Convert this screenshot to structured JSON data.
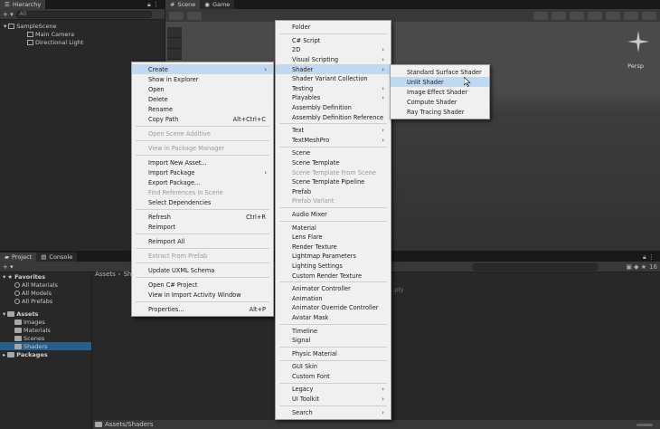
{
  "hierarchy": {
    "tab_label": "Hierarchy",
    "add_label": "+ ▾",
    "search_placeholder": "All",
    "items": [
      {
        "label": "SampleScene"
      },
      {
        "label": "Main Camera"
      },
      {
        "label": "Directional Light"
      }
    ]
  },
  "scene": {
    "tabs": [
      {
        "label": "Scene"
      },
      {
        "label": "Game"
      }
    ],
    "gizmo_label": "Persp"
  },
  "project": {
    "tabs": [
      {
        "label": "Project"
      },
      {
        "label": "Console"
      }
    ],
    "favorites_label": "Favorites",
    "favorites": [
      "All Materials",
      "All Models",
      "All Prefabs"
    ],
    "assets_label": "Assets",
    "asset_folders": [
      "Images",
      "Materials",
      "Scenes",
      "Shaders"
    ],
    "packages_label": "Packages",
    "breadcrumb": [
      "Assets",
      "Shad"
    ],
    "empty_hint": "...pty",
    "path_label": "Assets/Shaders",
    "count_label": "16"
  },
  "context_menu": {
    "items": [
      {
        "label": "Create",
        "submenu": true,
        "highlighted": true
      },
      {
        "label": "Show in Explorer"
      },
      {
        "label": "Open"
      },
      {
        "label": "Delete"
      },
      {
        "label": "Rename"
      },
      {
        "label": "Copy Path",
        "shortcut": "Alt+Ctrl+C"
      },
      {
        "sep": true
      },
      {
        "label": "Open Scene Additive",
        "disabled": true
      },
      {
        "sep": true
      },
      {
        "label": "View in Package Manager",
        "disabled": true
      },
      {
        "sep": true
      },
      {
        "label": "Import New Asset..."
      },
      {
        "label": "Import Package",
        "submenu": true
      },
      {
        "label": "Export Package..."
      },
      {
        "label": "Find References In Scene",
        "disabled": true
      },
      {
        "label": "Select Dependencies"
      },
      {
        "sep": true
      },
      {
        "label": "Refresh",
        "shortcut": "Ctrl+R"
      },
      {
        "label": "Reimport"
      },
      {
        "sep": true
      },
      {
        "label": "Reimport All"
      },
      {
        "sep": true
      },
      {
        "label": "Extract From Prefab",
        "disabled": true
      },
      {
        "sep": true
      },
      {
        "label": "Update UXML Schema"
      },
      {
        "sep": true
      },
      {
        "label": "Open C# Project"
      },
      {
        "label": "View in Import Activity Window"
      },
      {
        "sep": true
      },
      {
        "label": "Properties...",
        "shortcut": "Alt+P"
      }
    ]
  },
  "create_menu": {
    "items": [
      {
        "label": "Folder"
      },
      {
        "sep": true
      },
      {
        "label": "C# Script"
      },
      {
        "label": "2D",
        "submenu": true
      },
      {
        "label": "Visual Scripting",
        "submenu": true
      },
      {
        "label": "Shader",
        "submenu": true,
        "highlighted": true
      },
      {
        "label": "Shader Variant Collection"
      },
      {
        "label": "Testing",
        "submenu": true
      },
      {
        "label": "Playables",
        "submenu": true
      },
      {
        "label": "Assembly Definition"
      },
      {
        "label": "Assembly Definition Reference"
      },
      {
        "sep": true
      },
      {
        "label": "Text",
        "submenu": true
      },
      {
        "label": "TextMeshPro",
        "submenu": true
      },
      {
        "sep": true
      },
      {
        "label": "Scene"
      },
      {
        "label": "Scene Template"
      },
      {
        "label": "Scene Template From Scene",
        "disabled": true
      },
      {
        "label": "Scene Template Pipeline"
      },
      {
        "label": "Prefab"
      },
      {
        "label": "Prefab Variant",
        "disabled": true
      },
      {
        "sep": true
      },
      {
        "label": "Audio Mixer"
      },
      {
        "sep": true
      },
      {
        "label": "Material"
      },
      {
        "label": "Lens Flare"
      },
      {
        "label": "Render Texture"
      },
      {
        "label": "Lightmap Parameters"
      },
      {
        "label": "Lighting Settings"
      },
      {
        "label": "Custom Render Texture"
      },
      {
        "sep": true
      },
      {
        "label": "Animator Controller"
      },
      {
        "label": "Animation"
      },
      {
        "label": "Animator Override Controller"
      },
      {
        "label": "Avatar Mask"
      },
      {
        "sep": true
      },
      {
        "label": "Timeline"
      },
      {
        "label": "Signal"
      },
      {
        "sep": true
      },
      {
        "label": "Physic Material"
      },
      {
        "sep": true
      },
      {
        "label": "GUI Skin"
      },
      {
        "label": "Custom Font"
      },
      {
        "sep": true
      },
      {
        "label": "Legacy",
        "submenu": true
      },
      {
        "label": "UI Toolkit",
        "submenu": true
      },
      {
        "sep": true
      },
      {
        "label": "Search",
        "submenu": true
      }
    ]
  },
  "shader_menu": {
    "items": [
      {
        "label": "Standard Surface Shader"
      },
      {
        "label": "Unlit Shader",
        "highlighted": true
      },
      {
        "label": "Image Effect Shader"
      },
      {
        "label": "Compute Shader"
      },
      {
        "label": "Ray Tracing Shader"
      }
    ]
  },
  "colors": {
    "selection": "#2c5d87",
    "menu_bg": "#f0f0f0",
    "menu_highlight": "#bfd9f3"
  }
}
